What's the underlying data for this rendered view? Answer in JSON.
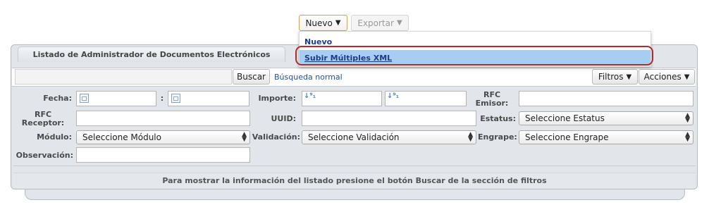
{
  "toolbar": {
    "nuevo_label": "Nuevo",
    "exportar_label": "Exportar"
  },
  "menu": {
    "items": [
      {
        "label": "Nuevo"
      },
      {
        "label": "Subir Múltiples XML"
      }
    ]
  },
  "panel": {
    "title": "Listado de Administrador de Documentos Electrónicos",
    "search_button": "Buscar",
    "search_mode_link": "Búsqueda normal",
    "filtros_label": "Filtros",
    "acciones_label": "Acciones"
  },
  "filters": {
    "fecha_label": "Fecha:",
    "fecha_separator": ":",
    "importe_label": "Importe:",
    "rfc_emisor_label_1": "RFC",
    "rfc_emisor_label_2": "Emisor:",
    "rfc_receptor_label_1": "RFC",
    "rfc_receptor_label_2": "Receptor:",
    "uuid_label": "UUID:",
    "estatus_label": "Estatus:",
    "estatus_value": "Seleccione Estatus",
    "modulo_label": "Módulo:",
    "modulo_value": "Seleccione Módulo",
    "validacion_label": "Validación:",
    "validacion_value": "Seleccione Validación",
    "engrape_label": "Engrape:",
    "engrape_value": "Seleccione Engrape",
    "observacion_label": "Observación:"
  },
  "footer_message": "Para mostrar la información del listado presione el botón Buscar de la sección de filtros",
  "icons": {
    "dropdown": "triangle-down",
    "sort": "sort-numeric-icon",
    "calendar": "calendar-icon",
    "select": "updown-arrows"
  },
  "colors": {
    "highlight": "#a7cdf3",
    "ring": "#b42a2a",
    "link": "#2150a0",
    "panel": "#e2e6eb"
  }
}
